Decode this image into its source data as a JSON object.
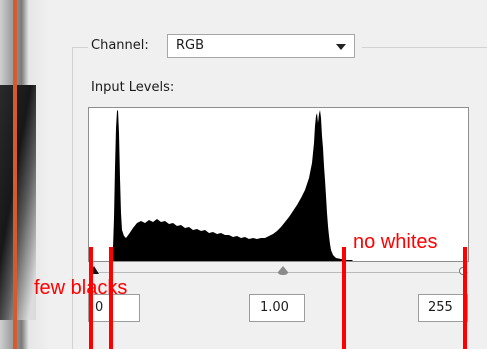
{
  "channel": {
    "label": "Channel:",
    "value": "RGB"
  },
  "input_levels": {
    "label": "Input Levels:",
    "black_point": "0",
    "gamma": "1.00",
    "white_point": "255"
  },
  "annotations": {
    "few_blacks": "few blacks",
    "no_whites": "no whites"
  },
  "colors": {
    "annotation": "#ff0000",
    "histogram": "#000000",
    "accent_bar": "#d65a2e"
  }
}
